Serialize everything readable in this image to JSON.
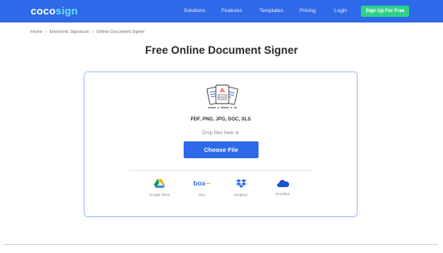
{
  "header": {
    "logo_part1": "coco",
    "logo_part2": "sign",
    "nav": [
      "Solutions",
      "Features",
      "Templates",
      "Pricing",
      "Login"
    ],
    "signup_label": "Sign Up For Free"
  },
  "breadcrumb": [
    "Home",
    "Electronic Signature",
    "Online Document Signer"
  ],
  "breadcrumb_sep": "›",
  "page_title": "Free Online Document Signer",
  "upload": {
    "formats": "PDF, PNG, JPG, DOC, XLS",
    "drop_hint": "Drop files here or",
    "choose_label": "Choose File",
    "illustration_badge": "PDF",
    "sources": [
      {
        "name": "Google Drive",
        "icon": "google-drive-icon"
      },
      {
        "name": "Box",
        "icon": "box-icon"
      },
      {
        "name": "Dropbox",
        "icon": "dropbox-icon"
      },
      {
        "name": "Onedrive",
        "icon": "onedrive-icon"
      }
    ]
  },
  "colors": {
    "primary": "#2d69e8",
    "signup": "#2fd08a",
    "logo_accent": "#6fe0ff"
  }
}
